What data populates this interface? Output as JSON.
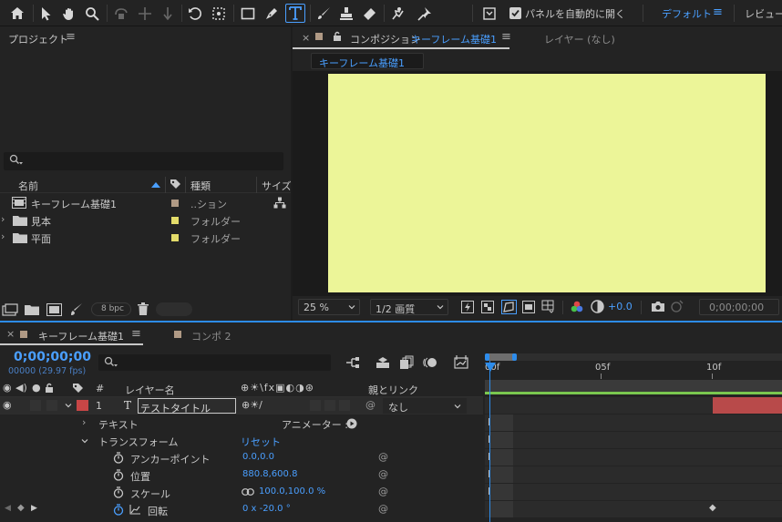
{
  "toolbar": {
    "tools": [
      "home-icon",
      "selection-tool-icon",
      "hand-tool-icon",
      "zoom-tool-icon",
      "orbit-camera-icon",
      "pan-camera-icon",
      "dolly-camera-icon",
      "rotation-tool-icon",
      "pan-behind-icon",
      "rectangle-tool-icon",
      "pen-tool-icon",
      "type-tool-icon",
      "brush-tool-icon",
      "clone-stamp-icon",
      "eraser-tool-icon",
      "roto-brush-icon",
      "puppet-pin-icon"
    ],
    "auto_open_label": "パネルを自動的に開く",
    "workspace_default": "デフォルト",
    "workspace_review": "レビュー"
  },
  "project": {
    "title": "プロジェクト",
    "search_placeholder": "",
    "columns": {
      "name": "名前",
      "type": "種類",
      "size": "サイズ"
    },
    "items": [
      {
        "name": "キーフレーム基礎1",
        "type": "..ション",
        "swatch": "#b09a85"
      },
      {
        "name": "見本",
        "type": "フォルダー",
        "swatch": "#e3dc6a"
      },
      {
        "name": "平面",
        "type": "フォルダー",
        "swatch": "#e3dc6a"
      }
    ],
    "bpc": "8 bpc"
  },
  "comp": {
    "tab_prefix": "コンポジション",
    "tab_name": "キーフレーム基礎1",
    "layer_tab": "レイヤー (なし)",
    "breadcrumb": "キーフレーム基礎1",
    "canvas_color": "#ecf598",
    "zoom": "25 %",
    "resolution": "1/2 画質",
    "exposure": "+0.0",
    "timecode": "0;00;00;00"
  },
  "timeline": {
    "tabs": [
      "キーフレーム基礎1",
      "コンポ 2"
    ],
    "timecode": "0;00;00;00",
    "frames": "00000 (29.97 fps)",
    "columns": {
      "num": "#",
      "layer_name": "レイヤー名",
      "parent": "親とリンク"
    },
    "layer": {
      "num": "1",
      "name": "テストタイトル",
      "parent": "なし",
      "label_color": "#c84646"
    },
    "text_group": "テキスト",
    "animator": "アニメーター :",
    "transform": "トランスフォーム",
    "reset": "リセット",
    "properties": [
      {
        "name": "アンカーポイント",
        "value": "0.0,0.0"
      },
      {
        "name": "位置",
        "value": "880.8,600.8"
      },
      {
        "name": "スケール",
        "value": "100.0,100.0 %"
      },
      {
        "name": "回転",
        "value": "0 x -20.0 °"
      }
    ],
    "ruler": [
      "00f",
      "05f",
      "10f"
    ]
  }
}
